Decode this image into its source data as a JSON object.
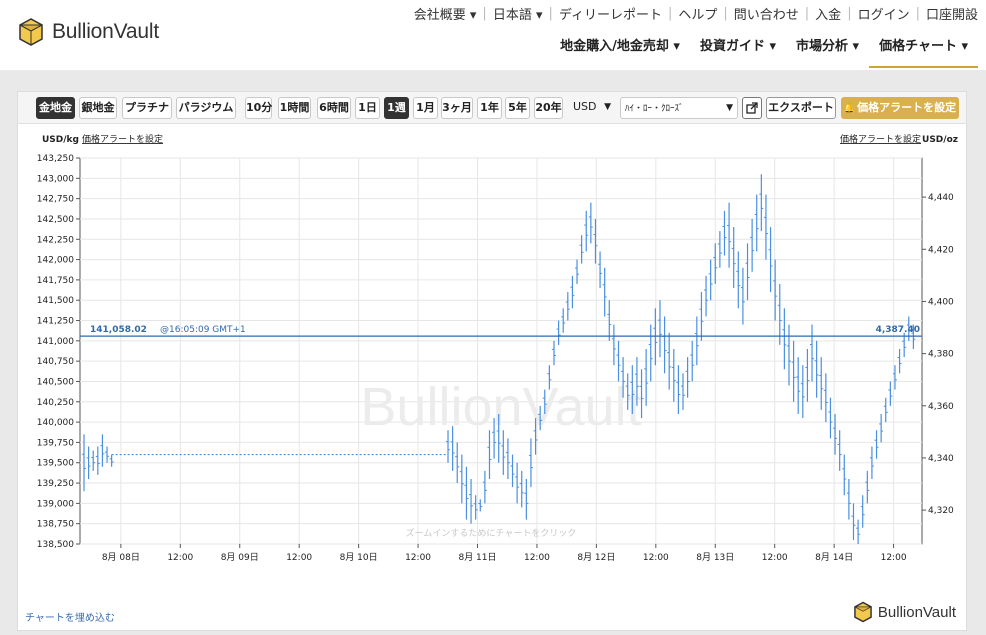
{
  "brand": {
    "name": "BullionVault"
  },
  "topnav": [
    "会社概要 ▾",
    "日本語 ▾",
    "ディリーレポート",
    "ヘルプ",
    "問い合わせ",
    "入金",
    "ログイン",
    "口座開設"
  ],
  "mainnav": [
    "地金購入/地金売却 ▾",
    "投資ガイド ▾",
    "市場分析 ▾",
    "価格チャート ▾"
  ],
  "toolbar": {
    "metals": [
      "金地金",
      "銀地金",
      "プラチナ",
      "パラジウム"
    ],
    "ranges": [
      "10分",
      "1時間",
      "6時間",
      "1日",
      "1週",
      "1月",
      "3ヶ月",
      "1年",
      "5年",
      "20年"
    ],
    "currency": "USD",
    "chart_style": "ﾊｲ・ﾛｰ・ｸﾛｰｽﾞ",
    "export": "エクスポート",
    "alert": "価格アラートを設定"
  },
  "chart_labels": {
    "left_unit": "USD/kg",
    "left_alert": "価格アラートを設定",
    "right_alert": "価格アラートを設定",
    "right_unit": "USD/oz",
    "current_left": "141,058.02",
    "current_time": "@16:05:09 GMT+1",
    "current_right": "4,387.40",
    "watermark": "BullionVault",
    "zoom_hint": "ズームインするためにチャートをクリック",
    "embed": "チャートを埋め込む"
  },
  "chart_data": {
    "type": "ohlc",
    "y_left": {
      "label": "USD/kg",
      "ticks": [
        "143,250",
        "143,000",
        "142,750",
        "142,500",
        "142,250",
        "142,000",
        "141,750",
        "141,500",
        "141,250",
        "141,000",
        "140,750",
        "140,500",
        "140,250",
        "140,000",
        "139,750",
        "139,500",
        "139,250",
        "139,000",
        "138,750",
        "138,500"
      ],
      "range": [
        138500,
        143250
      ]
    },
    "y_right": {
      "label": "USD/oz",
      "ticks": [
        "4,440",
        "4,420",
        "4,400",
        "4,380",
        "4,360",
        "4,340",
        "4,320"
      ],
      "range": [
        4307,
        4455
      ]
    },
    "x_ticks": [
      "8月 08日",
      "12:00",
      "8月 09日",
      "12:00",
      "8月 10日",
      "12:00",
      "8月 11日",
      "12:00",
      "8月 12日",
      "12:00",
      "8月 13日",
      "12:00",
      "8月 14日",
      "12:00"
    ],
    "current_value_usd_kg": 141058.02,
    "series": [
      {
        "x": [
          0,
          1,
          2,
          3,
          4,
          5,
          6
        ],
        "high": [
          139850,
          139700,
          139650,
          139700,
          139850,
          139700,
          139600
        ],
        "low": [
          139150,
          139300,
          139400,
          139350,
          139450,
          139500,
          139450
        ]
      },
      {
        "x": [
          79,
          80,
          81,
          82,
          83,
          84,
          85,
          86,
          87,
          88,
          89,
          90,
          91,
          92,
          93,
          94,
          95,
          96,
          97,
          98
        ],
        "high": [
          139900,
          139950,
          139750,
          139600,
          139450,
          139300,
          139100,
          139050,
          139400,
          139900,
          140050,
          140100,
          139900,
          139800,
          139600,
          139500,
          139400,
          139300,
          139800,
          140050
        ],
        "low": [
          139500,
          139400,
          139250,
          139000,
          138800,
          138750,
          138800,
          138900,
          139000,
          139300,
          139550,
          139500,
          139350,
          139300,
          139200,
          139000,
          138950,
          138800,
          139200,
          139600
        ]
      },
      {
        "x": [
          99,
          100,
          101,
          102,
          103,
          104,
          105,
          106,
          107,
          108,
          109,
          110,
          111,
          112,
          113,
          114,
          115,
          116,
          117,
          118
        ],
        "high": [
          140200,
          140400,
          140700,
          141000,
          141250,
          141400,
          141600,
          141800,
          142000,
          142300,
          142600,
          142700,
          142500,
          142100,
          141900,
          141500,
          141200,
          141000,
          140800,
          140600
        ],
        "low": [
          139900,
          140100,
          140400,
          140700,
          140950,
          141100,
          141250,
          141400,
          141700,
          141950,
          142100,
          142200,
          141950,
          141650,
          141300,
          141000,
          140700,
          140500,
          140300,
          140150
        ]
      },
      {
        "x": [
          119,
          120,
          121,
          122,
          123,
          124,
          125,
          126,
          127,
          128,
          129,
          130,
          131,
          132,
          133,
          134,
          135,
          136,
          137,
          138
        ],
        "high": [
          140700,
          140800,
          140650,
          140900,
          141200,
          141400,
          141500,
          141300,
          141100,
          140900,
          140700,
          140600,
          140800,
          141000,
          141300,
          141600,
          141800,
          142000,
          142200,
          142350
        ],
        "low": [
          140100,
          140200,
          140050,
          140200,
          140500,
          140700,
          140800,
          140600,
          140400,
          140250,
          140100,
          140150,
          140300,
          140500,
          140700,
          141000,
          141300,
          141500,
          141700,
          141900
        ]
      },
      {
        "x": [
          139,
          140,
          141,
          142,
          143,
          144,
          145,
          146,
          147,
          148,
          149,
          150,
          151,
          152,
          153,
          154,
          155,
          156,
          157,
          158,
          159,
          160
        ],
        "high": [
          142600,
          142700,
          142400,
          142100,
          141900,
          142200,
          142500,
          142800,
          143050,
          142800,
          142400,
          142000,
          141700,
          141400,
          141200,
          141000,
          140800,
          140700,
          140900,
          141200,
          141000,
          140800
        ],
        "low": [
          142050,
          141900,
          141650,
          141400,
          141200,
          141500,
          141850,
          142100,
          142350,
          142000,
          141600,
          141250,
          140950,
          140650,
          140450,
          140250,
          140100,
          140050,
          140250,
          140500,
          140300,
          140150
        ]
      },
      {
        "x": [
          161,
          162,
          163,
          164,
          165,
          166,
          167,
          168,
          169,
          170,
          171,
          172,
          173,
          174,
          175,
          176,
          177,
          178,
          179,
          180
        ],
        "high": [
          140600,
          140300,
          140100,
          139900,
          139600,
          139300,
          139000,
          138800,
          139100,
          139400,
          139700,
          139900,
          140100,
          140300,
          140500,
          140700,
          140900,
          141100,
          141300,
          141200
        ],
        "low": [
          140000,
          139800,
          139600,
          139400,
          139100,
          138800,
          138550,
          138500,
          138700,
          139000,
          139300,
          139550,
          139750,
          140000,
          140200,
          140400,
          140600,
          140800,
          141000,
          140900
        ]
      }
    ]
  }
}
